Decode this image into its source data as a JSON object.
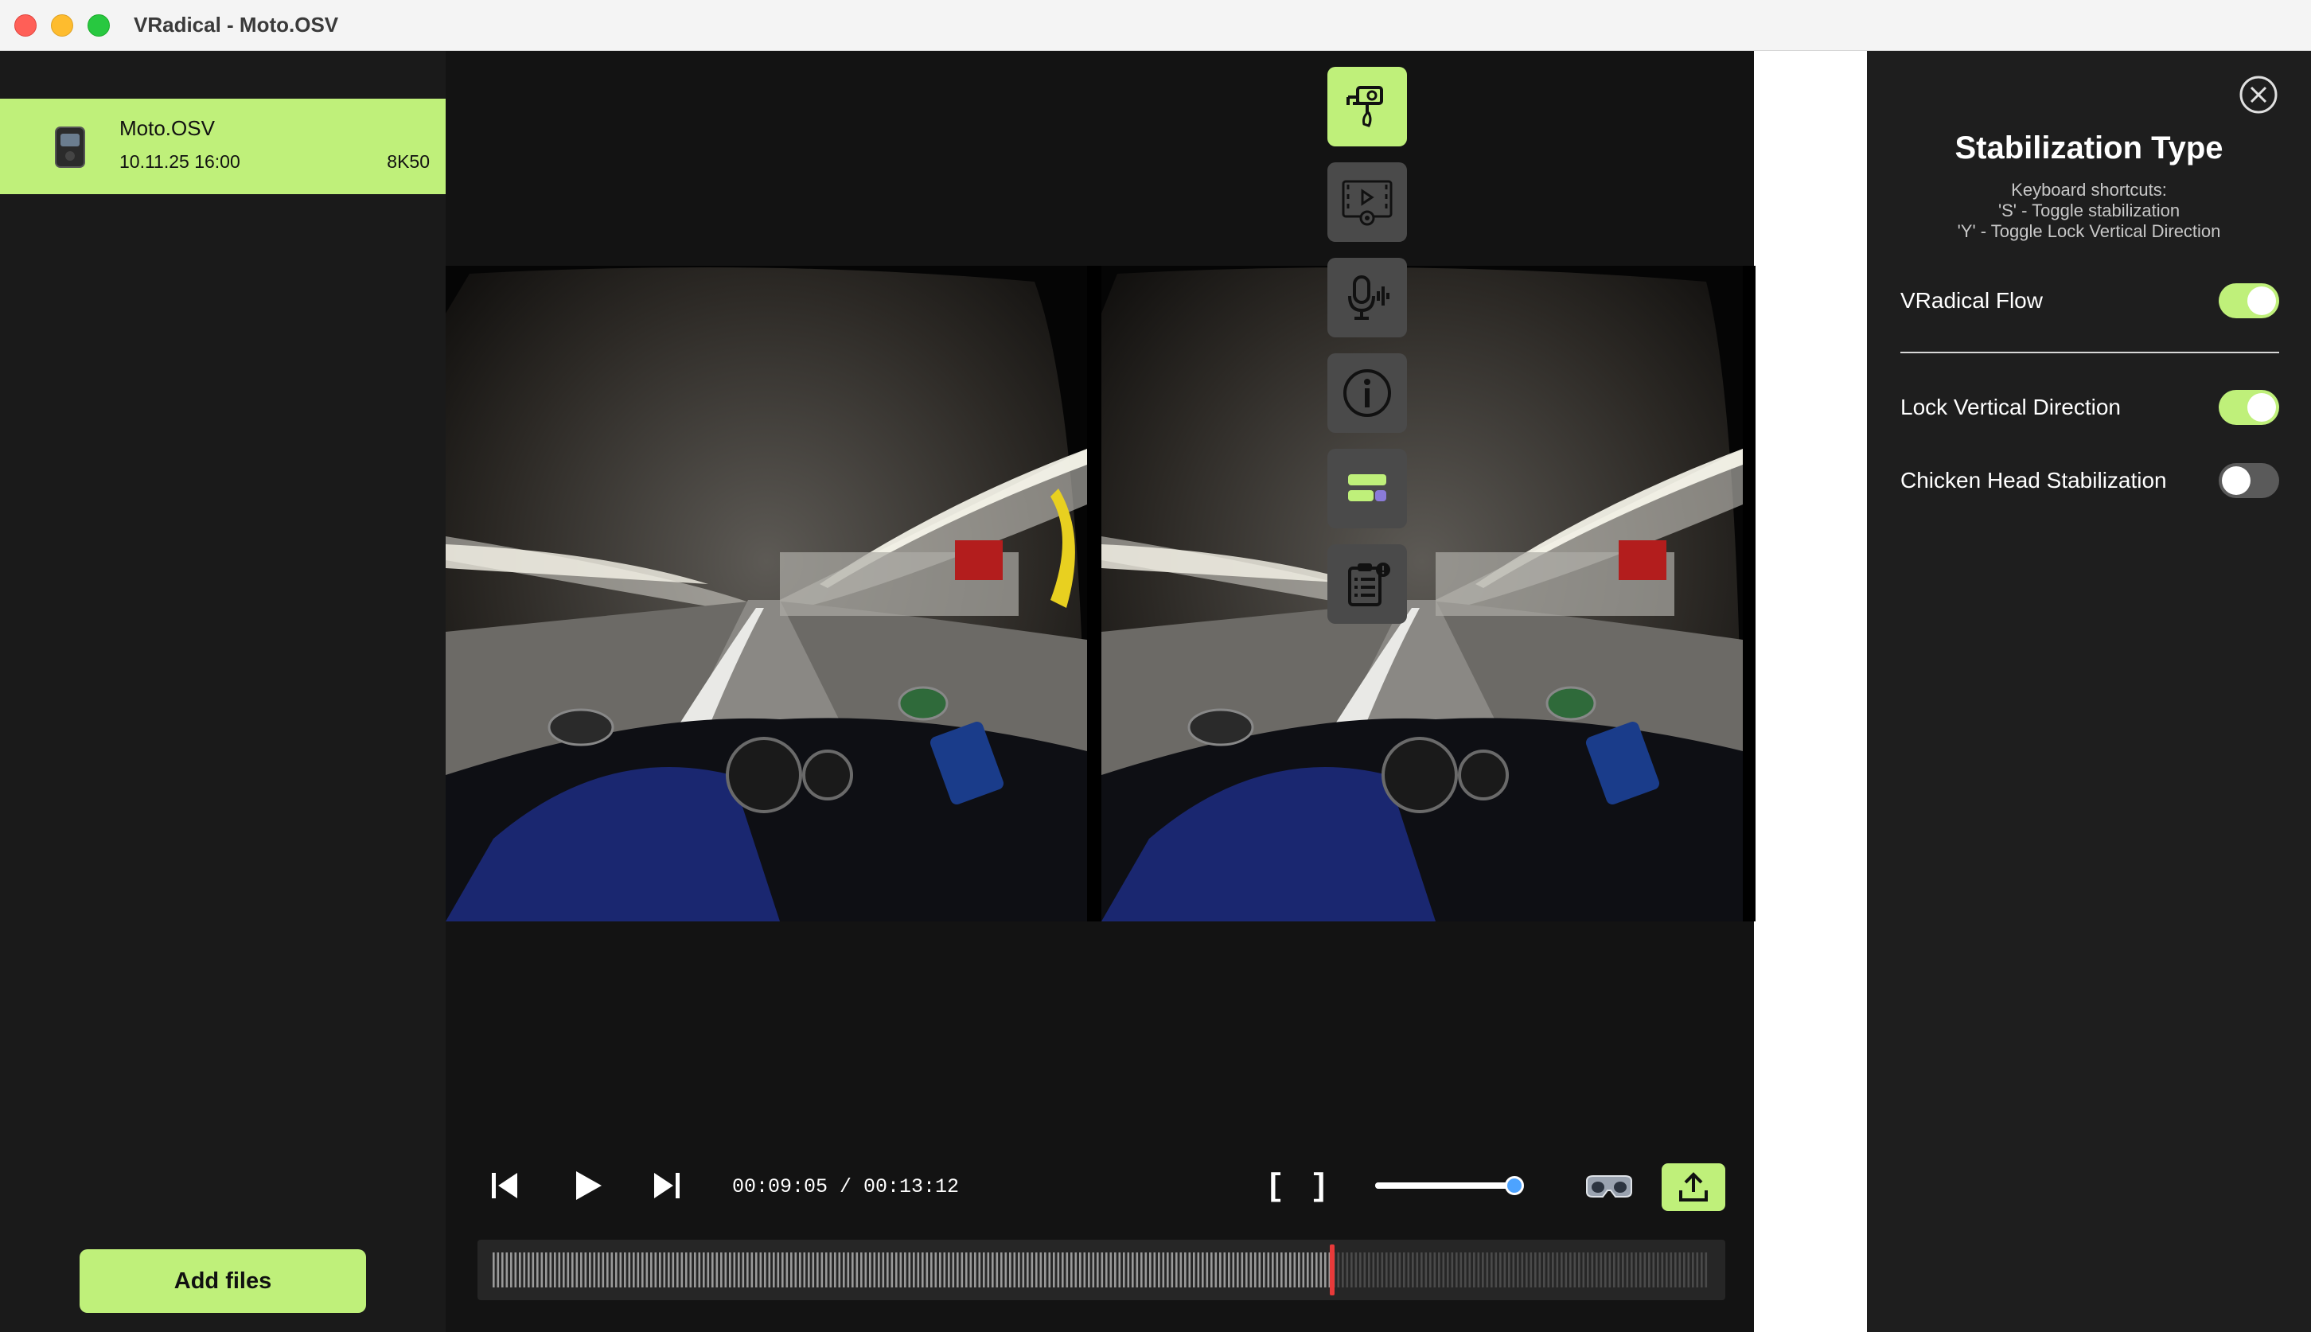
{
  "window": {
    "title": "VRadical - Moto.OSV"
  },
  "sidebar": {
    "files": [
      {
        "name": "Moto.OSV",
        "date": "10.11.25 16:00",
        "resolution": "8K50",
        "selected": true
      }
    ],
    "add_files_label": "Add files"
  },
  "tools": [
    {
      "name": "stabilization",
      "icon": "camera-gimbal-icon",
      "active": true
    },
    {
      "name": "video-settings",
      "icon": "film-gear-icon",
      "active": false
    },
    {
      "name": "audio",
      "icon": "microphone-icon",
      "active": false
    },
    {
      "name": "info",
      "icon": "info-icon",
      "active": false
    },
    {
      "name": "layout",
      "icon": "layout-blocks-icon",
      "active": false
    },
    {
      "name": "notes",
      "icon": "clipboard-list-icon",
      "active": false
    }
  ],
  "panel": {
    "title": "Stabilization Type",
    "shortcuts": [
      "Keyboard shortcuts:",
      "'S' - Toggle stabilization",
      "'Y' - Toggle Lock Vertical Direction"
    ],
    "options": [
      {
        "label": "VRadical Flow",
        "enabled": true
      },
      {
        "label": "Lock Vertical Direction",
        "enabled": true
      },
      {
        "label": "Chicken Head Stabilization",
        "enabled": false
      }
    ]
  },
  "player": {
    "current_time": "00:09:05",
    "total_time": "00:13:12",
    "timecode": "00:09:05 / 00:13:12",
    "in_mark_label": "[",
    "out_mark_label": "]",
    "volume": 0.95,
    "playhead_fraction": 0.69
  },
  "colors": {
    "accent": "#bff07a",
    "playhead": "#e83a3a",
    "panel_bg": "#1e1e1e",
    "sidebar_bg": "#1a1a1a",
    "main_bg": "#131313"
  }
}
